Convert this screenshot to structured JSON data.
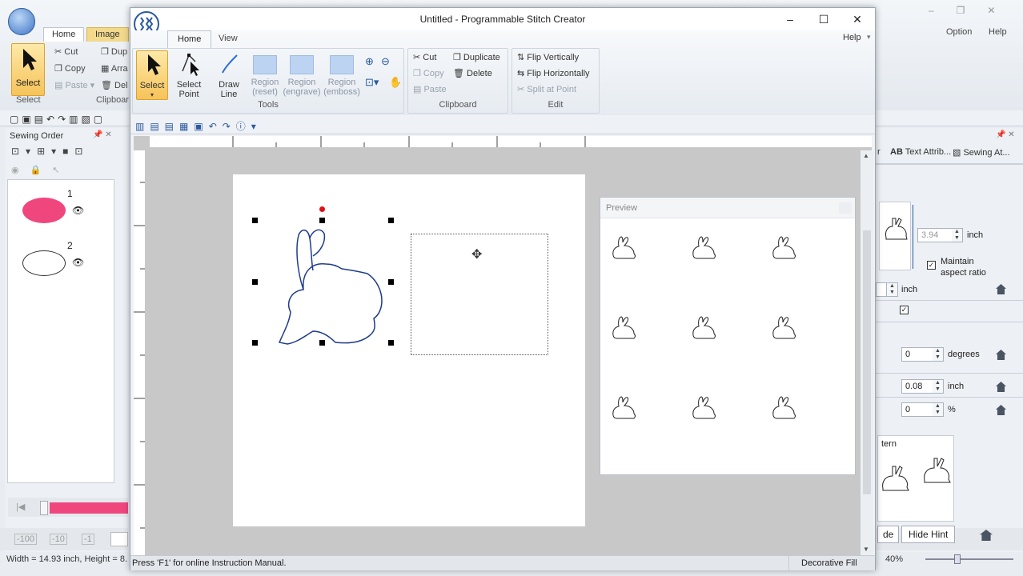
{
  "bg_app": {
    "tabs": [
      "Home",
      "Image"
    ],
    "ribbon_buttons": {
      "select": "Select",
      "cut": "Cut",
      "copy": "Copy",
      "paste": "Paste",
      "dup": "Dup",
      "arrange": "Arra",
      "delete": "Del"
    },
    "group_labels": {
      "select": "Select",
      "clipboard": "Clipboar"
    },
    "right_top": {
      "option": "Option",
      "help": "Help"
    },
    "sewing_order": {
      "title": "Sewing Order",
      "items": [
        {
          "num": "1",
          "shape": "pink-oval"
        },
        {
          "num": "2",
          "shape": "white-oval"
        }
      ]
    },
    "right_panel": {
      "tabs": [
        "r",
        "Text Attrib...",
        "Sewing At..."
      ],
      "width_value": "3.94",
      "width_unit": "inch",
      "maintain_aspect": "Maintain\naspect ratio",
      "height_unit": "inch",
      "rotate_value": "0",
      "rotate_unit": "degrees",
      "spacing_value": "0.08",
      "spacing_unit": "inch",
      "percent_value": "0",
      "percent_unit": "%",
      "pattern_label": "tern",
      "hint_left": "de",
      "hide_hint": "Hide Hint",
      "zoom": "40%"
    },
    "bottom_left": {
      "values": [
        "-100",
        "-10",
        "-1"
      ],
      "status": "Width = 14.93 inch, Height = 8."
    }
  },
  "window": {
    "title": "Untitled - Programmable Stitch Creator",
    "help": "Help",
    "tabs": [
      "Home",
      "View"
    ],
    "tools": {
      "select": "Select",
      "select_point": "Select\nPoint",
      "draw_line": "Draw\nLine",
      "region_reset": "Region\n(reset)",
      "region_engrave": "Region\n(engrave)",
      "region_emboss": "Region\n(emboss)"
    },
    "clipboard": {
      "cut": "Cut",
      "copy": "Copy",
      "paste": "Paste",
      "duplicate": "Duplicate",
      "delete": "Delete"
    },
    "edit": {
      "flip_v": "Flip Vertically",
      "flip_h": "Flip Horizontally",
      "split": "Split at Point"
    },
    "group_labels": {
      "tools": "Tools",
      "clipboard": "Clipboard",
      "edit": "Edit"
    },
    "preview": {
      "title": "Preview",
      "tiles": 9
    },
    "status_left": "Press 'F1' for online Instruction Manual.",
    "status_right": "Decorative Fill"
  },
  "colors": {
    "accent": "#f7c14f",
    "ribbon_blue": "#2a5aa0",
    "pink": "#f0467e"
  }
}
